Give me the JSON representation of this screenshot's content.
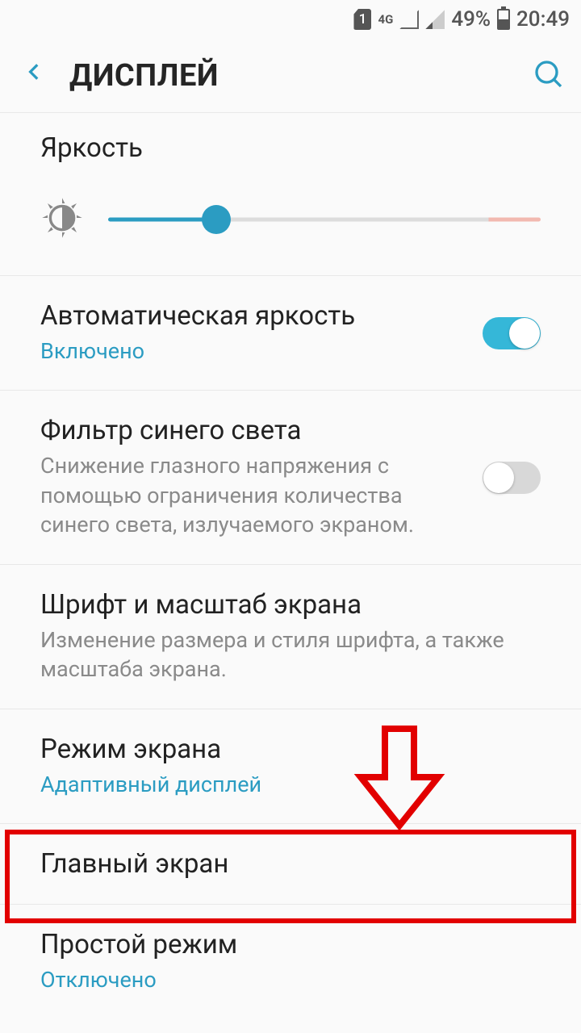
{
  "status": {
    "battery": "49%",
    "time": "20:49",
    "sim": "1",
    "net": "4G"
  },
  "header": {
    "title": "ДИСПЛЕЙ"
  },
  "brightness": {
    "label": "Яркость"
  },
  "auto_brightness": {
    "label": "Автоматическая яркость",
    "status": "Включено"
  },
  "blue_filter": {
    "label": "Фильтр синего света",
    "desc": "Снижение глазного напряжения с помощью ограничения количества синего света, излучаемого экраном."
  },
  "font_scale": {
    "label": "Шрифт и масштаб экрана",
    "desc": "Изменение размера и стиля шрифта, а также масштаба экрана."
  },
  "screen_mode": {
    "label": "Режим экрана",
    "value": "Адаптивный дисплей"
  },
  "home_screen": {
    "label": "Главный экран"
  },
  "easy_mode": {
    "label": "Простой режим",
    "status": "Отключено"
  }
}
